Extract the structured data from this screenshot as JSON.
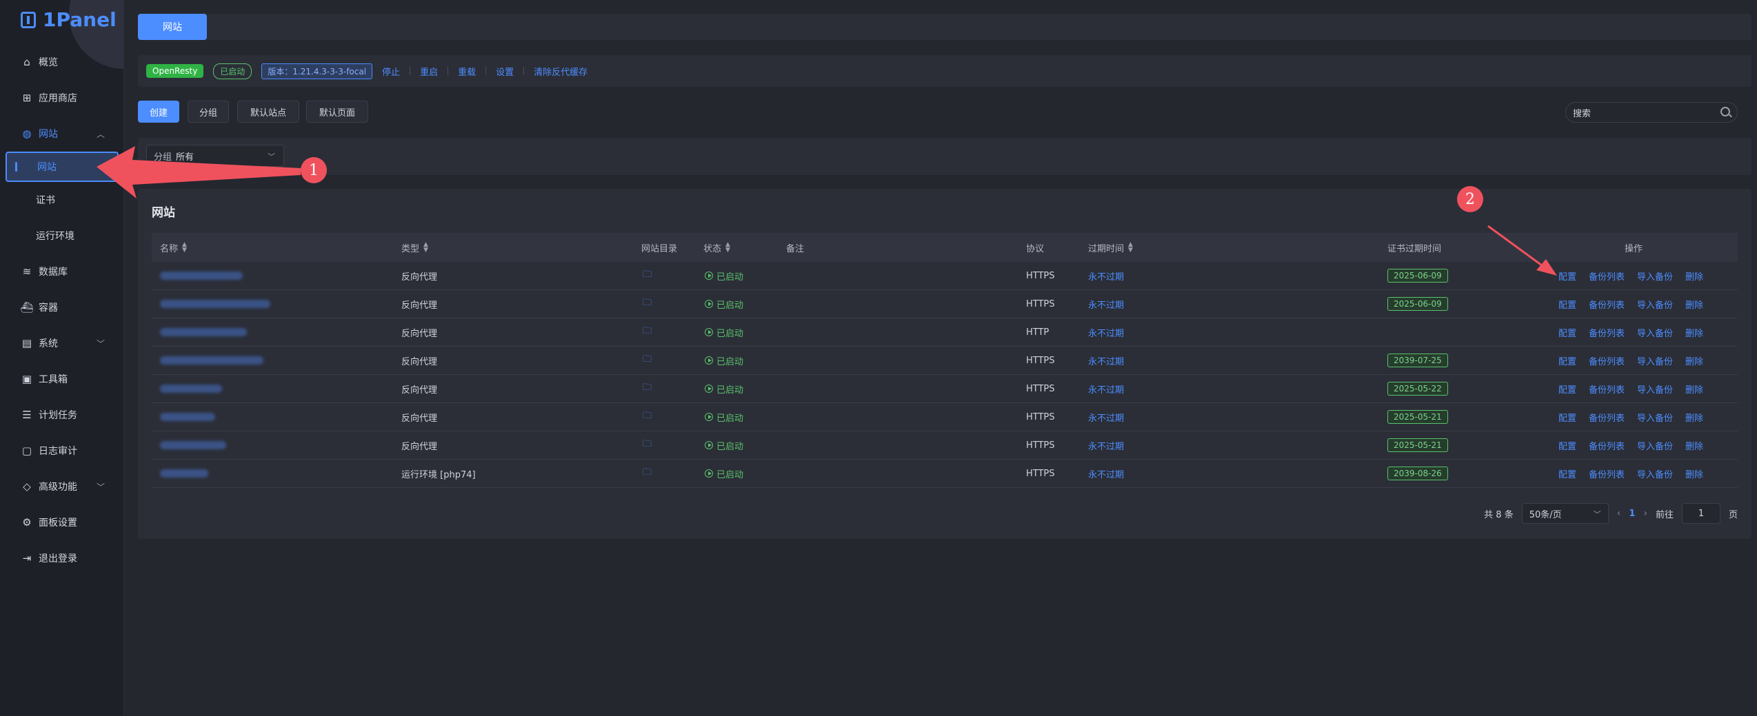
{
  "brand": {
    "name": "1Panel"
  },
  "sidebar": {
    "items": [
      {
        "label": "概览",
        "icon": "home-icon"
      },
      {
        "label": "应用商店",
        "icon": "grid-icon"
      },
      {
        "label": "网站",
        "icon": "globe-icon",
        "expanded": true
      },
      {
        "label": "网站",
        "sub": true,
        "selected": true
      },
      {
        "label": "证书",
        "sub": true
      },
      {
        "label": "运行环境",
        "sub": true
      },
      {
        "label": "数据库",
        "icon": "layers-icon"
      },
      {
        "label": "容器",
        "icon": "docker-icon"
      },
      {
        "label": "系统",
        "icon": "server-icon",
        "expandable": true
      },
      {
        "label": "工具箱",
        "icon": "toolbox-icon"
      },
      {
        "label": "计划任务",
        "icon": "list-icon"
      },
      {
        "label": "日志审计",
        "icon": "log-icon"
      },
      {
        "label": "高级功能",
        "icon": "diamond-icon",
        "expandable": true
      },
      {
        "label": "面板设置",
        "icon": "gear-icon"
      },
      {
        "label": "退出登录",
        "icon": "logout-icon"
      }
    ]
  },
  "topbar": {
    "tab_label": "网站"
  },
  "status": {
    "app_name": "OpenResty",
    "state": "已启动",
    "version": "版本：1.21.4.3-3-3-focal",
    "actions": [
      "停止",
      "重启",
      "重载",
      "设置",
      "清除反代缓存"
    ]
  },
  "toolbar": {
    "create": "创建",
    "group": "分组",
    "default_site": "默认站点",
    "default_page": "默认页面",
    "search_placeholder": "搜索"
  },
  "filter": {
    "label": "分组",
    "value": "所有"
  },
  "panel": {
    "title": "网站"
  },
  "table": {
    "columns": [
      "名称",
      "类型",
      "网站目录",
      "状态",
      "备注",
      "协议",
      "过期时间",
      "证书过期时间",
      "操作"
    ],
    "rows": [
      {
        "type": "反向代理",
        "status": "已启动",
        "protocol": "HTTPS",
        "expire": "永不过期",
        "cert": "2025-06-09"
      },
      {
        "type": "反向代理",
        "status": "已启动",
        "protocol": "HTTPS",
        "expire": "永不过期",
        "cert": "2025-06-09"
      },
      {
        "type": "反向代理",
        "status": "已启动",
        "protocol": "HTTP",
        "expire": "永不过期",
        "cert": ""
      },
      {
        "type": "反向代理",
        "status": "已启动",
        "protocol": "HTTPS",
        "expire": "永不过期",
        "cert": "2039-07-25"
      },
      {
        "type": "反向代理",
        "status": "已启动",
        "protocol": "HTTPS",
        "expire": "永不过期",
        "cert": "2025-05-22"
      },
      {
        "type": "反向代理",
        "status": "已启动",
        "protocol": "HTTPS",
        "expire": "永不过期",
        "cert": "2025-05-21"
      },
      {
        "type": "反向代理",
        "status": "已启动",
        "protocol": "HTTPS",
        "expire": "永不过期",
        "cert": "2025-05-21"
      },
      {
        "type": "运行环境 [php74]",
        "status": "已启动",
        "protocol": "HTTPS",
        "expire": "永不过期",
        "cert": "2039-08-26"
      }
    ],
    "row_actions": [
      "配置",
      "备份列表",
      "导入备份",
      "删除"
    ]
  },
  "pagination": {
    "total": "共 8 条",
    "page_size": "50条/页",
    "current": "1",
    "goto_label": "前往",
    "goto_value": "1",
    "page_suffix": "页"
  },
  "annotations": {
    "badge1": "1",
    "badge2": "2",
    "arrow_color": "#f0525d"
  }
}
